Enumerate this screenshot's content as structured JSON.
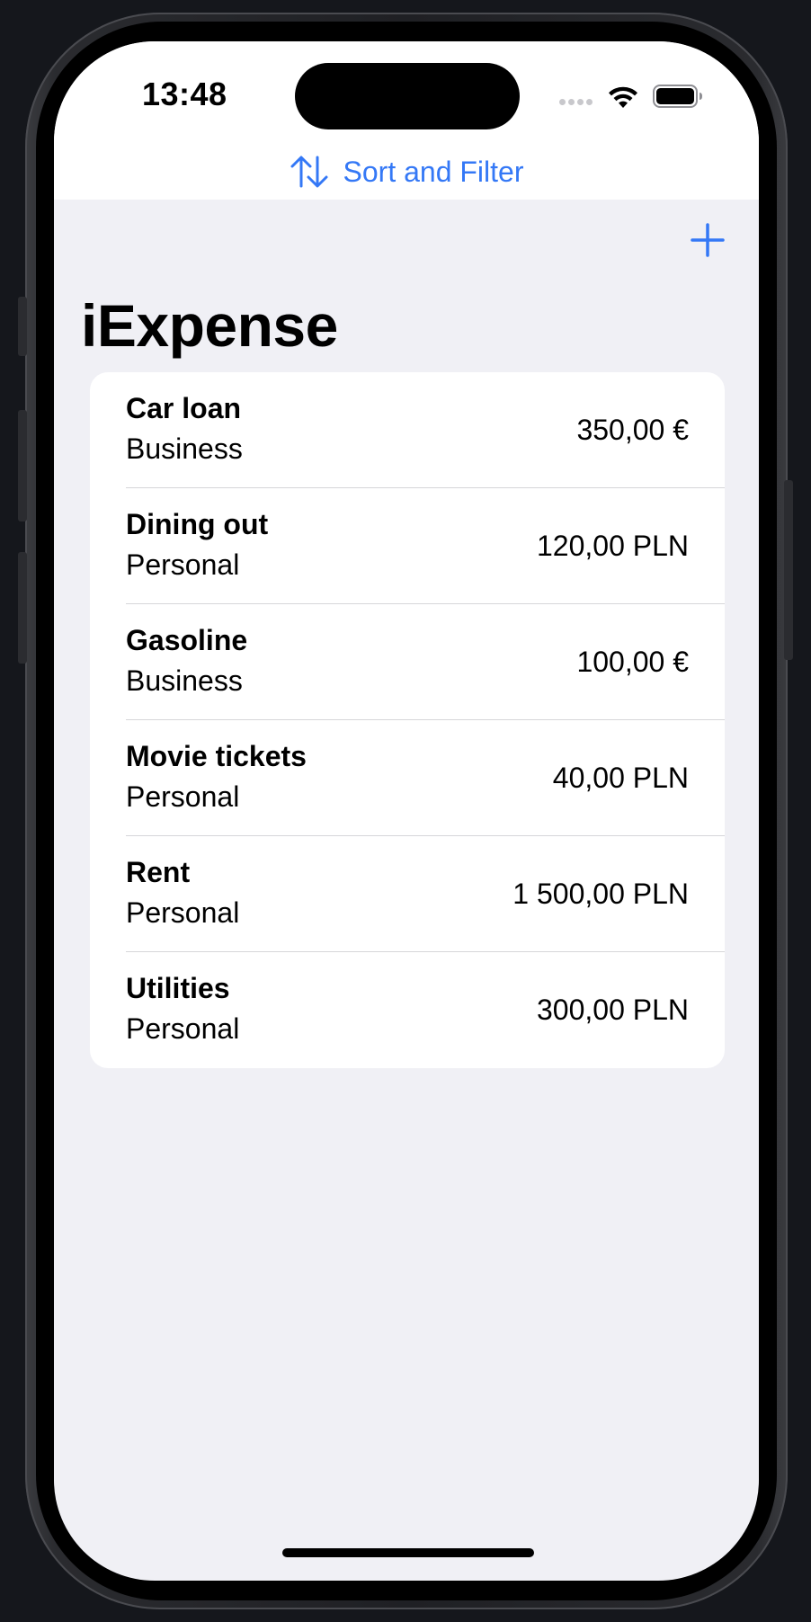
{
  "status_bar": {
    "time": "13:48"
  },
  "toolbar": {
    "sort_filter_label": "Sort and Filter",
    "accent_color": "#3478f6"
  },
  "page": {
    "title": "iExpense"
  },
  "expenses": [
    {
      "name": "Car loan",
      "type": "Business",
      "amount": "350,00 €"
    },
    {
      "name": "Dining out",
      "type": "Personal",
      "amount": "120,00 PLN"
    },
    {
      "name": "Gasoline",
      "type": "Business",
      "amount": "100,00 €"
    },
    {
      "name": "Movie tickets",
      "type": "Personal",
      "amount": "40,00 PLN"
    },
    {
      "name": "Rent",
      "type": "Personal",
      "amount": "1 500,00 PLN"
    },
    {
      "name": "Utilities",
      "type": "Personal",
      "amount": "300,00 PLN"
    }
  ],
  "icons": {
    "sort": "arrow-up-arrow-down-icon",
    "add": "plus-icon",
    "wifi": "wifi-icon",
    "battery": "battery-icon"
  }
}
